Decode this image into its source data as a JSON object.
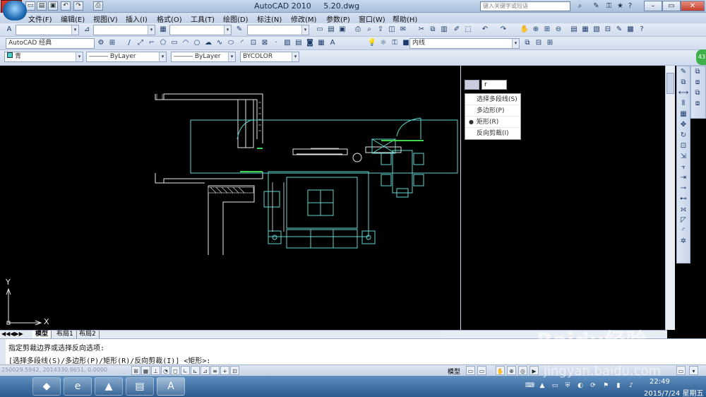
{
  "title": {
    "app_name": "AutoCAD 2010",
    "file_name": "5.20.dwg",
    "search_placeholder": "键入关键字或短语"
  },
  "menu": [
    "文件(F)",
    "编辑(E)",
    "视图(V)",
    "插入(I)",
    "格式(O)",
    "工具(T)",
    "绘图(D)",
    "标注(N)",
    "修改(M)",
    "参数(P)",
    "窗口(W)",
    "帮助(H)"
  ],
  "toolbar": {
    "workspace": "AutoCAD 经典",
    "layer": "青",
    "linetype": "ByLayer",
    "lineweight": "ByLayer",
    "plotstyle": "BYCOLOR",
    "layer_right": "内线"
  },
  "popup": {
    "input_value": "r",
    "options": [
      {
        "label": "选择多段线(S)",
        "selected": false
      },
      {
        "label": "多边形(P)",
        "selected": false
      },
      {
        "label": "矩形(R)",
        "selected": true
      },
      {
        "label": "反向剪裁(I)",
        "selected": false
      }
    ]
  },
  "layout_tabs": [
    "模型",
    "布局1",
    "布局2"
  ],
  "command": {
    "line1": "指定剪裁边界或选择反向选项:",
    "line2": "[选择多段线(S)/多边形(P)/矩形(R)/反向剪裁(I)] <矩形>:"
  },
  "status": {
    "coords": "250029.5942, 2014330.9651, 0.0000",
    "model_label": "模型"
  },
  "taskbar": {
    "time": "22:49",
    "date": "2015/7/24 星期五"
  },
  "watermark": {
    "brand": "Baidu经验",
    "url": "jingyan.baidu.com"
  },
  "axis": {
    "y": "Y",
    "x": "X"
  },
  "colors": {
    "drawing_bg": "#000000",
    "cyan_line": "#5fd6d0",
    "white_line": "#e8e8e8",
    "green_accent": "#3fd24a"
  }
}
